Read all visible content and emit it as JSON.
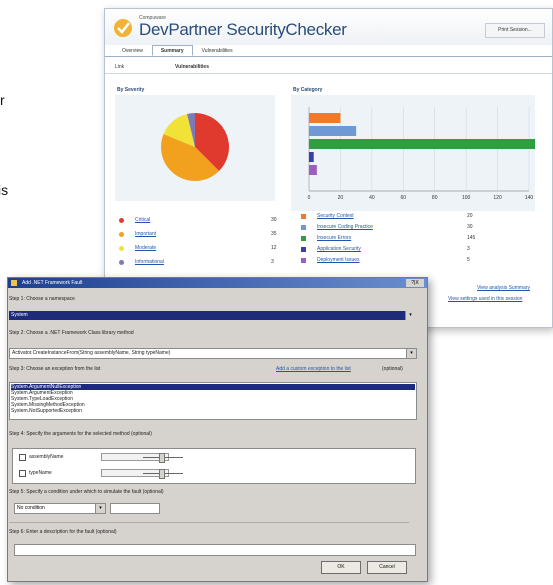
{
  "fragments": [
    "r",
    "is"
  ],
  "back_window": {
    "brand_small": "Compuware",
    "app_title": "DevPartner SecurityChecker",
    "header_button": "Print Session...",
    "tabs": [
      "Overview",
      "Summary",
      "Vulnerabilities"
    ],
    "active_tab": 1,
    "subbar": {
      "left": "Link",
      "right": "Vulnerabilities"
    },
    "by_severity_label": "By Severity",
    "by_category_label": "By Category",
    "pie": {
      "slices": [
        {
          "name": "Critical",
          "value": 30,
          "color": "#e03a2f"
        },
        {
          "name": "Important",
          "value": 35,
          "color": "#f2a11f"
        },
        {
          "name": "Moderate",
          "value": 12,
          "color": "#f0e236"
        },
        {
          "name": "Informational",
          "value": 3,
          "color": "#7d7ab8"
        }
      ]
    },
    "severity_legend": [
      {
        "label": "Critical",
        "value": "30",
        "color": "#e03a2f"
      },
      {
        "label": "Important",
        "value": "35",
        "color": "#f2a11f"
      },
      {
        "label": "Moderate",
        "value": "12",
        "color": "#f0e236"
      },
      {
        "label": "Informational",
        "value": "3",
        "color": "#7d7ab8"
      }
    ],
    "category_chart": {
      "axis_ticks": [
        "0",
        "20",
        "40",
        "60",
        "80",
        "100",
        "120",
        "140"
      ],
      "bars": [
        {
          "name": "Security Context",
          "value": 20,
          "color": "#f07a2a"
        },
        {
          "name": "Insecure Coding Practice",
          "value": 30,
          "color": "#6f99d4"
        },
        {
          "name": "Insecure Errors",
          "value": 145,
          "color": "#2e9e3e"
        },
        {
          "name": "Application Security",
          "value": 3,
          "color": "#3b3fa8"
        },
        {
          "name": "Deployment Issues",
          "value": 5,
          "color": "#9a5fc0"
        }
      ],
      "xmax": 145
    },
    "category_legend": [
      {
        "label": "Security Context",
        "value": "20",
        "color": "#f07a2a"
      },
      {
        "label": "Insecure Coding Practice",
        "value": "30",
        "color": "#6f99d4"
      },
      {
        "label": "Insecure Errors",
        "value": "145",
        "color": "#2e9e3e"
      },
      {
        "label": "Application Security",
        "value": "3",
        "color": "#3b3fa8"
      },
      {
        "label": "Deployment Issues",
        "value": "5",
        "color": "#9a5fc0"
      }
    ],
    "links": [
      "View analysis Summary",
      "View settings used in this session"
    ]
  },
  "dialog": {
    "title": "Add .NET Framework Fault",
    "title_buttons": "?|X",
    "step1": "Step 1: Choose a namespace",
    "step1_value": "System",
    "step2": "Step 2: Choose a .NET Framework Class library method",
    "step2_value": "Activator.CreateInstanceFrom(String assemblyName, String typeName)",
    "step3": "Step 3: Choose an exception from the list",
    "step3_link": "Add a custom exception to the list",
    "step3_optional": "(optional)",
    "exceptions": [
      "System.ArgumentNullException",
      "System.ArgumentException",
      "System.TypeLoadException",
      "System.MissingMethodException",
      "System.NotSupportedException"
    ],
    "step4": "Step 4: Specify the arguments for the selected method (optional)",
    "params": [
      "assemblyName",
      "typeName"
    ],
    "step5": "Step 5: Specify a condition under which to simulate the fault (optional)",
    "condition_value": "No condition",
    "step6": "Step 6: Enter a description for the fault (optional)",
    "ok": "OK",
    "cancel": "Cancel"
  }
}
